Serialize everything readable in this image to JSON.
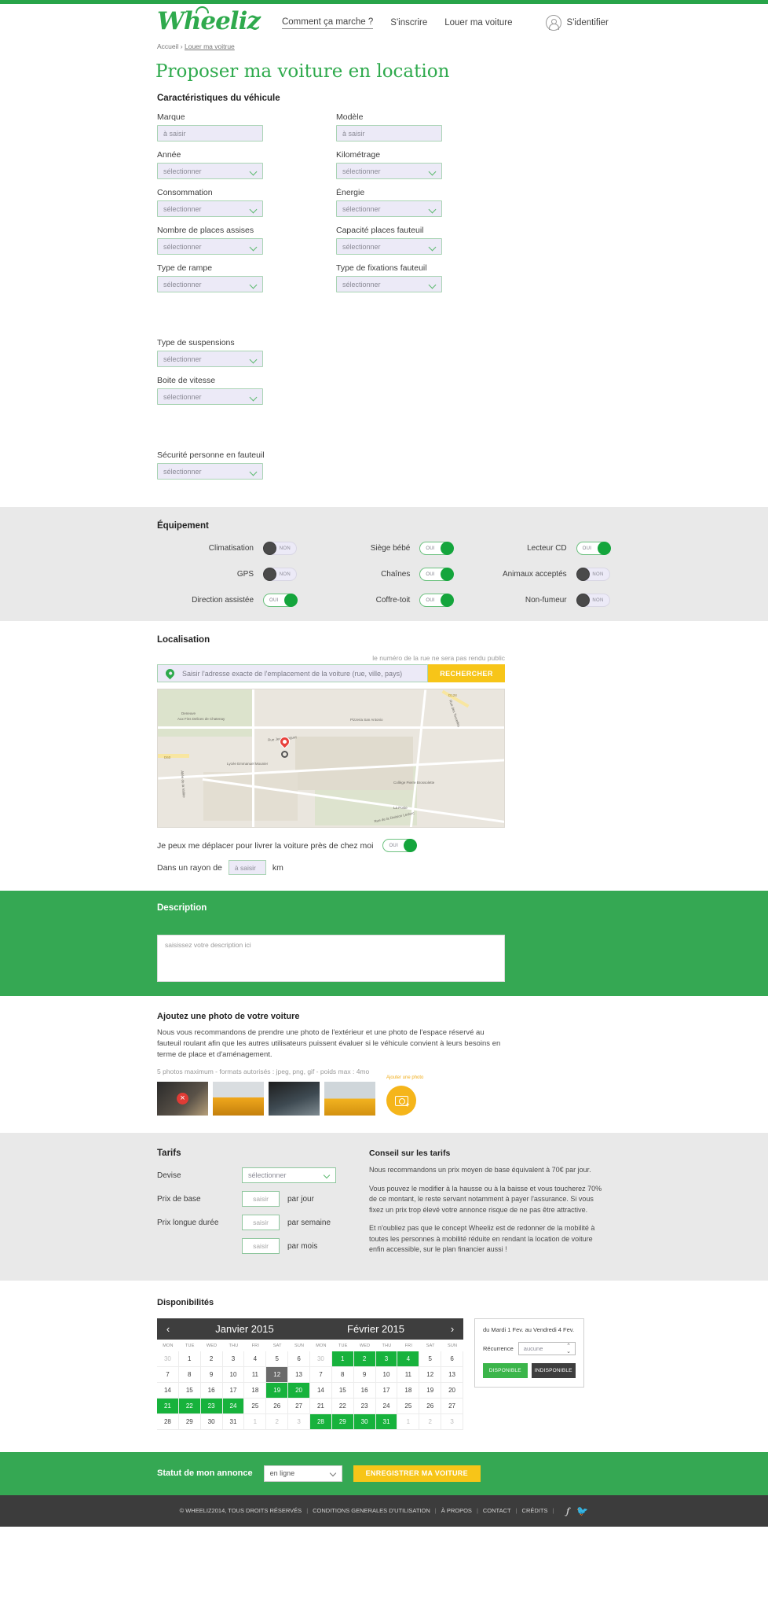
{
  "header": {
    "logo": "Wheeliz",
    "nav": [
      {
        "label": "Comment ça marche ?",
        "active": true
      },
      {
        "label": "S'inscrire",
        "active": false
      },
      {
        "label": "Louer ma voiture",
        "active": false
      }
    ],
    "login_label": "S'identifier",
    "avatar_icon": "user-circle-icon"
  },
  "breadcrumb": {
    "home": "Accueil",
    "sep": "›",
    "current": "Louer ma voitrue"
  },
  "page_title": "Proposer ma voiture en location",
  "vehicle": {
    "section_title": "Caractéristiques du véhicule",
    "fields": [
      {
        "label": "Marque",
        "value": "à saisir",
        "type": "text"
      },
      {
        "label": "Année",
        "value": "sélectionner",
        "type": "select"
      },
      {
        "label": "Consommation",
        "value": "sélectionner",
        "type": "select"
      },
      {
        "label": "Nombre de places assises",
        "value": "sélectionner",
        "type": "select"
      },
      {
        "label": "Type de rampe",
        "value": "sélectionner",
        "type": "select"
      },
      {
        "label": "Modèle",
        "value": "à saisir",
        "type": "text"
      },
      {
        "label": "Kilométrage",
        "value": "sélectionner",
        "type": "select"
      },
      {
        "label": "Énergie",
        "value": "sélectionner",
        "type": "select"
      },
      {
        "label": "Capacité places fauteuil",
        "value": "sélectionner",
        "type": "select"
      },
      {
        "label": "Type de fixations fauteuil",
        "value": "sélectionner",
        "type": "select"
      },
      {
        "label": "Type de suspensions",
        "value": "sélectionner",
        "type": "select"
      },
      {
        "label": "Boite de vitesse",
        "value": "sélectionner",
        "type": "select"
      },
      {
        "label": "Sécurité personne en fauteuil",
        "value": "sélectionner",
        "type": "select"
      }
    ]
  },
  "equipment": {
    "section_title": "Équipement",
    "on_label": "OUI",
    "off_label": "NON",
    "items": [
      {
        "label": "Climatisation",
        "on": false
      },
      {
        "label": "Siège bébé",
        "on": true
      },
      {
        "label": "Lecteur CD",
        "on": true
      },
      {
        "label": "GPS",
        "on": false
      },
      {
        "label": "Chaînes",
        "on": true
      },
      {
        "label": "Animaux acceptés",
        "on": false
      },
      {
        "label": "Direction assistée",
        "on": true
      },
      {
        "label": "Coffre-toit",
        "on": true
      },
      {
        "label": "Non-fumeur",
        "on": false
      }
    ]
  },
  "localisation": {
    "section_title": "Localisation",
    "hint": "le numéro de la rue ne sera pas rendu public",
    "placeholder": "Saisir l'adresse exacte de l'emplacement de la voiture (rue, ville, pays)",
    "search_button": "RECHERCHER",
    "pin_icon": "map-pin-icon",
    "map_labels": [
      "Pizzeria San Antonio",
      "Rue des Tourelles",
      "Lycée Emmanuel Mounier",
      "Collège Pierre Brossolette",
      "La Poste",
      "Aux Fins Delices de Chatenay",
      "Rue Jean Longuet",
      "Rue de la Division Leclerc",
      "Allée de la Vallée",
      "Deneuve",
      "D986",
      "D128",
      "D60"
    ],
    "deliver_label": "Je peux me déplacer pour livrer la voiture près de chez moi",
    "deliver_on": true,
    "radius_label": "Dans un rayon de",
    "radius_value": "à saisir",
    "radius_unit": "km"
  },
  "description": {
    "section_title": "Description",
    "placeholder": "saisissez votre description ici"
  },
  "photos": {
    "title": "Ajoutez une photo de votre voiture",
    "text": "Nous vous recommandons de prendre une photo de l'extérieur et une photo de l'espace réservé au fauteuil roulant afin que les autres utilisateurs puissent évaluer si le véhicule convient à leurs besoins en terme de place et d'aménagement.",
    "meta": "5 photos maximum - formats autorisés : jpeg, png, gif - poids max : 4mo",
    "add_label": "Ajouter une photo",
    "remove_icon": "close-icon",
    "camera_icon": "camera-plus-icon"
  },
  "tarifs": {
    "title": "Tarifs",
    "rows": [
      {
        "label": "Devise",
        "value": "sélectionner",
        "unit": "",
        "type": "select"
      },
      {
        "label": "Prix de base",
        "value": "saisir",
        "unit": "par jour",
        "type": "text"
      },
      {
        "label": "Prix longue durée",
        "value": "saisir",
        "unit": "par semaine",
        "type": "text"
      },
      {
        "label": "",
        "value": "saisir",
        "unit": "par mois",
        "type": "text"
      }
    ],
    "advice_title": "Conseil sur les tarifs",
    "advice": [
      "Nous recommandons un prix moyen de base équivalent à 70€ par jour.",
      "Vous pouvez le modifier à la hausse ou à la baisse et vous toucherez 70% de ce montant, le reste servant notamment à payer l'assurance. Si vous fixez un prix trop élevé votre annonce risque de ne pas être attractive.",
      "Et n'oubliez pas que le concept Wheeliz est de redonner de la mobilité à toutes les personnes à mobilité réduite en rendant la location de voiture enfin accessible, sur le plan financier aussi !"
    ]
  },
  "disponibilites": {
    "title": "Disponibilités",
    "prev_icon": "chevron-left-icon",
    "next_icon": "chevron-right-icon",
    "month_left": "Janvier 2015",
    "month_right": "Février 2015",
    "dow": [
      "MON",
      "TUE",
      "WED",
      "THU",
      "FRI",
      "SAT",
      "SUN"
    ],
    "weeks_left": [
      [
        {
          "d": "30",
          "s": "mut"
        },
        {
          "d": "1",
          "s": ""
        },
        {
          "d": "2",
          "s": ""
        },
        {
          "d": "3",
          "s": ""
        },
        {
          "d": "4",
          "s": ""
        },
        {
          "d": "5",
          "s": ""
        },
        {
          "d": "6",
          "s": ""
        }
      ],
      [
        {
          "d": "7",
          "s": ""
        },
        {
          "d": "8",
          "s": ""
        },
        {
          "d": "9",
          "s": ""
        },
        {
          "d": "10",
          "s": ""
        },
        {
          "d": "11",
          "s": ""
        },
        {
          "d": "12",
          "s": "sel"
        },
        {
          "d": "13",
          "s": ""
        }
      ],
      [
        {
          "d": "14",
          "s": ""
        },
        {
          "d": "15",
          "s": ""
        },
        {
          "d": "16",
          "s": ""
        },
        {
          "d": "17",
          "s": ""
        },
        {
          "d": "18",
          "s": ""
        },
        {
          "d": "19",
          "s": "avail"
        },
        {
          "d": "20",
          "s": "avail"
        }
      ],
      [
        {
          "d": "21",
          "s": "avail"
        },
        {
          "d": "22",
          "s": "avail"
        },
        {
          "d": "23",
          "s": "avail"
        },
        {
          "d": "24",
          "s": "avail"
        },
        {
          "d": "25",
          "s": ""
        },
        {
          "d": "26",
          "s": ""
        },
        {
          "d": "27",
          "s": ""
        }
      ],
      [
        {
          "d": "28",
          "s": ""
        },
        {
          "d": "29",
          "s": ""
        },
        {
          "d": "30",
          "s": ""
        },
        {
          "d": "31",
          "s": ""
        },
        {
          "d": "1",
          "s": "mut"
        },
        {
          "d": "2",
          "s": "mut"
        },
        {
          "d": "3",
          "s": "mut"
        }
      ]
    ],
    "weeks_right": [
      [
        {
          "d": "30",
          "s": "mut"
        },
        {
          "d": "1",
          "s": "avail"
        },
        {
          "d": "2",
          "s": "avail"
        },
        {
          "d": "3",
          "s": "avail"
        },
        {
          "d": "4",
          "s": "avail"
        },
        {
          "d": "5",
          "s": ""
        },
        {
          "d": "6",
          "s": ""
        }
      ],
      [
        {
          "d": "7",
          "s": ""
        },
        {
          "d": "8",
          "s": ""
        },
        {
          "d": "9",
          "s": ""
        },
        {
          "d": "10",
          "s": ""
        },
        {
          "d": "11",
          "s": ""
        },
        {
          "d": "12",
          "s": ""
        },
        {
          "d": "13",
          "s": ""
        }
      ],
      [
        {
          "d": "14",
          "s": ""
        },
        {
          "d": "15",
          "s": ""
        },
        {
          "d": "16",
          "s": ""
        },
        {
          "d": "17",
          "s": ""
        },
        {
          "d": "18",
          "s": ""
        },
        {
          "d": "19",
          "s": ""
        },
        {
          "d": "20",
          "s": ""
        }
      ],
      [
        {
          "d": "21",
          "s": ""
        },
        {
          "d": "22",
          "s": ""
        },
        {
          "d": "23",
          "s": ""
        },
        {
          "d": "24",
          "s": ""
        },
        {
          "d": "25",
          "s": ""
        },
        {
          "d": "26",
          "s": ""
        },
        {
          "d": "27",
          "s": ""
        }
      ],
      [
        {
          "d": "28",
          "s": "avail"
        },
        {
          "d": "29",
          "s": "avail"
        },
        {
          "d": "30",
          "s": "avail"
        },
        {
          "d": "31",
          "s": "avail"
        },
        {
          "d": "1",
          "s": "mut"
        },
        {
          "d": "2",
          "s": "mut"
        },
        {
          "d": "3",
          "s": "mut"
        }
      ]
    ],
    "panel": {
      "range": "du Mardi 1 Fev. au Vendredi 4 Fev.",
      "recur_label": "Récurrence",
      "recur_value": "aucune",
      "btn_available": "DISPONIBLE",
      "btn_unavailable": "INDISPONIBLE"
    }
  },
  "statut": {
    "label": "Statut de mon annonce",
    "select_value": "en ligne",
    "save_button": "ENREGISTRER MA VOITURE"
  },
  "footer": {
    "copyright": "© WHEELIZ2014, TOUS DROITS RÉSERVÉS",
    "links": [
      "CONDITIONS GENERALES D'UTILISATION",
      "À PROPOS",
      "CONTACT",
      "CRÉDITS"
    ],
    "facebook_icon": "facebook-icon",
    "twitter_icon": "twitter-icon"
  },
  "colors": {
    "brand_green": "#2faa4d",
    "accent_yellow": "#f7c518",
    "available_green": "#17b23c",
    "dark": "#3e3e3e"
  }
}
